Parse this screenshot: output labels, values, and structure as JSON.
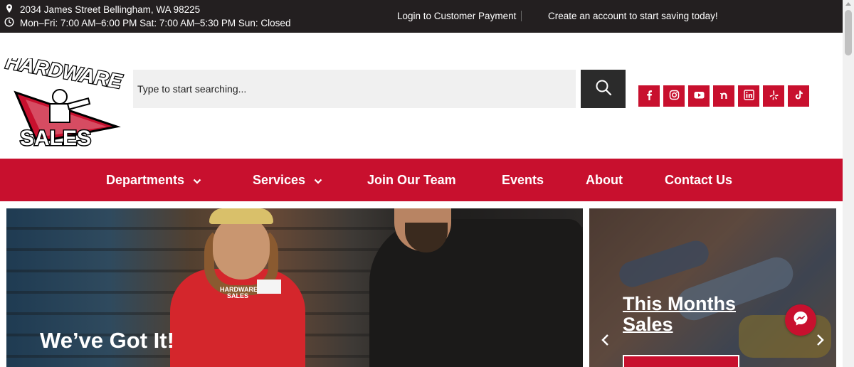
{
  "topbar": {
    "address": "2034 James Street Bellingham, WA 98225",
    "hours": "Mon–Fri: 7:00 AM–6:00 PM Sat: 7:00 AM–5:30 PM Sun: Closed",
    "login_link": "Login to Customer Payment",
    "account_link": "Create an account to start saving today!",
    "background": "#231f20"
  },
  "logo": {
    "top_text": "HARDWARE",
    "bottom_text": "SALES"
  },
  "search": {
    "placeholder": "Type to start searching..."
  },
  "socials": [
    {
      "name": "facebook"
    },
    {
      "name": "instagram"
    },
    {
      "name": "youtube"
    },
    {
      "name": "nextdoor"
    },
    {
      "name": "linkedin"
    },
    {
      "name": "yelp"
    },
    {
      "name": "tiktok"
    }
  ],
  "nav": {
    "items": [
      {
        "label": "Departments",
        "dropdown": true
      },
      {
        "label": "Services",
        "dropdown": true
      },
      {
        "label": "Join Our Team",
        "dropdown": false
      },
      {
        "label": "Events",
        "dropdown": false
      },
      {
        "label": "About",
        "dropdown": false
      },
      {
        "label": "Contact Us",
        "dropdown": false
      }
    ]
  },
  "hero": {
    "title": "We’ve Got It!",
    "shirt_logo_top": "HARDWARE",
    "shirt_logo_bottom": "SALES"
  },
  "side_panel": {
    "title_line1": "This Months",
    "title_line2": "Sales"
  },
  "colors": {
    "brand_red": "#c8102e",
    "dark": "#231f20",
    "search_bg": "#f0f0f0"
  }
}
